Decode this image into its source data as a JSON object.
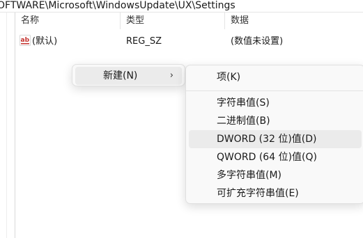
{
  "address_bar": {
    "path": "OFTWARE\\Microsoft\\WindowsUpdate\\UX\\Settings"
  },
  "columns": {
    "name": "名称",
    "type": "类型",
    "data": "数据"
  },
  "values": [
    {
      "icon": "string-value-icon",
      "name": "(默认)",
      "type": "REG_SZ",
      "data": "(数值未设置)"
    }
  ],
  "context_menu": {
    "new_label": "新建(N)",
    "chevron": "›"
  },
  "new_submenu": {
    "key": "项(K)",
    "string_value": "字符串值(S)",
    "binary_value": "二进制值(B)",
    "dword_value": "DWORD (32 位)值(D)",
    "qword_value": "QWORD (64 位)值(Q)",
    "multi_string_value": "多字符串值(M)",
    "expandable_string_value": "可扩充字符串值(E)",
    "hovered_item": "dword_value"
  },
  "colors": {
    "icon_red": "#c4322e",
    "hover_bg": "#ebebeb",
    "menu_bg": "#f9f9f9"
  }
}
